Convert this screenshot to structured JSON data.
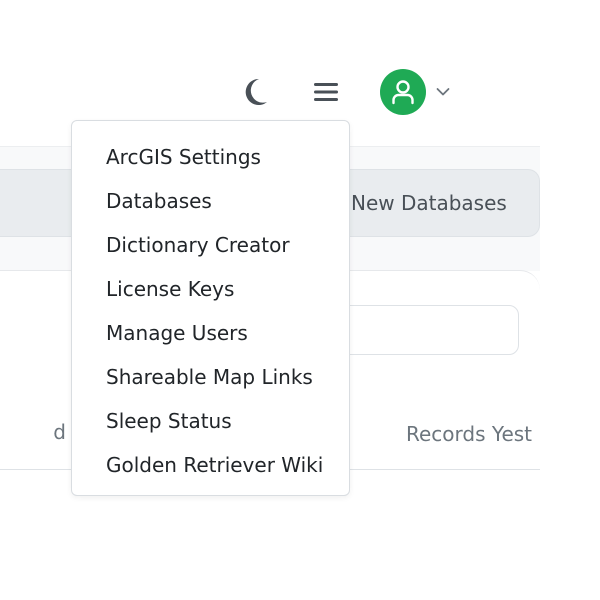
{
  "colors": {
    "icon": "#495057",
    "avatar_bg": "#1faa55",
    "avatar_fg": "#ffffff"
  },
  "topbar": {
    "theme_icon": "moon-icon",
    "menu_icon": "hamburger-menu-icon",
    "user_icon": "user-avatar-icon",
    "user_chevron_icon": "chevron-down-icon"
  },
  "background": {
    "new_databases_label": "New Databases",
    "column_left_fragment": "d",
    "column_right_fragment": "Records Yest"
  },
  "menu": {
    "items": [
      {
        "label": "ArcGIS Settings"
      },
      {
        "label": "Databases"
      },
      {
        "label": "Dictionary Creator"
      },
      {
        "label": "License Keys"
      },
      {
        "label": "Manage Users"
      },
      {
        "label": "Shareable Map Links"
      },
      {
        "label": "Sleep Status"
      },
      {
        "label": "Golden Retriever Wiki"
      }
    ]
  }
}
